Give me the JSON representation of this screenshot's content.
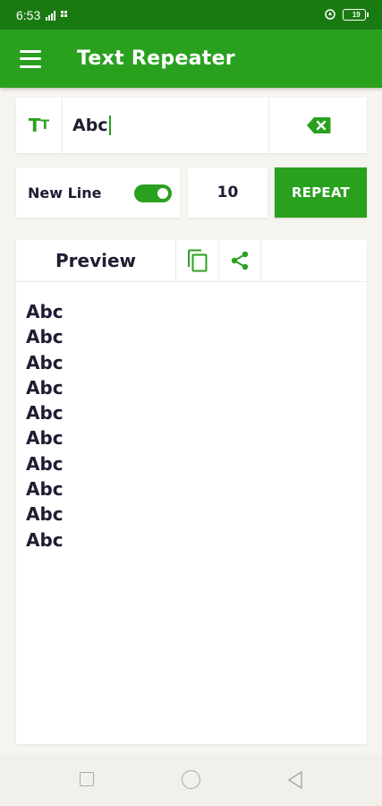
{
  "status_bar": {
    "time": "6:53",
    "battery_level": "19"
  },
  "app_bar": {
    "title": "Text Repeater",
    "menu_icon": "hamburger-menu-icon"
  },
  "text_input": {
    "font_icon_big": "T",
    "font_icon_small": "T",
    "value": "Abc",
    "clear_icon": "backspace-clear-icon"
  },
  "options": {
    "new_line_label": "New Line",
    "new_line_enabled": true,
    "repeat_count": "10",
    "repeat_label": "REPEAT"
  },
  "preview": {
    "title": "Preview",
    "copy_icon": "copy-icon",
    "share_icon": "share-icon",
    "lines": [
      "Abc",
      "Abc",
      "Abc",
      "Abc",
      "Abc",
      "Abc",
      "Abc",
      "Abc",
      "Abc",
      "Abc"
    ]
  },
  "nav": {
    "recent_icon": "recent-apps-icon",
    "home_icon": "home-icon",
    "back_icon": "back-icon"
  },
  "colors": {
    "primary": "#2aa01f",
    "status_bar": "#1a7a12",
    "text_dark": "#1d1d33",
    "background": "#f6f4ee"
  }
}
